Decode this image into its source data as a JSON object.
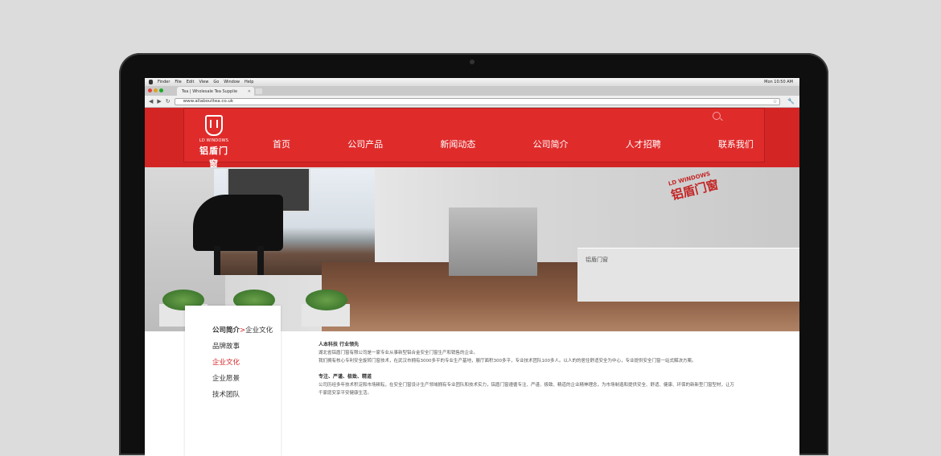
{
  "menubar": {
    "items": [
      "Finder",
      "File",
      "Edit",
      "View",
      "Go",
      "Window",
      "Help"
    ],
    "clock": "Mon 10:50 AM"
  },
  "browser": {
    "tab_title": "Tea | Wholesale Tea Supplie",
    "url": "www.allabouttea.co.uk"
  },
  "site": {
    "logo_en": "LD WINDOWS",
    "logo_cn": "铝盾门窗",
    "nav": [
      "首页",
      "公司产品",
      "新闻动态",
      "公司简介",
      "人才招聘",
      "联系我们"
    ],
    "banner": {
      "wall_logo_en": "LD WINDOWS",
      "wall_logo_cn": "铝盾门窗",
      "desk_logo": "铝盾门窗"
    },
    "breadcrumb": {
      "parent": "公司简介",
      "separator": ">",
      "current": "企业文化"
    },
    "sidebar": [
      "品牌故事",
      "企业文化",
      "企业愿景",
      "技术团队"
    ],
    "active_item": "企业文化",
    "content": {
      "heading1": "人本科技    行业领先",
      "para1": "湖北省铝盾门窗有限公司是一家专业从事新型铝合金安全门窗生产和销售的企业。",
      "para2": "我们拥有核心专利安全旋转门窗技术，在武汉市拥有3000多平的专业生产基地，展厅面积300多平，专业技术团队100多人。以人的的居住舒适安全为中心，专业提供安全门窗一站式解决方案。",
      "heading2": "专注、严谨、极致、精道",
      "para3": "公司历经多年技术积淀和市场耕耘，在安全门窗设计生产领域拥有专业团队和技术实力，铝盾门窗遵循专注、严谨、极致、精道的企业精神理念，为市场制造和提供安全、舒适、健康、环保的新新型门窗型材，让万千家庭安享平安健康生活。"
    }
  },
  "colors": {
    "brand_red": "#e02b2b"
  }
}
